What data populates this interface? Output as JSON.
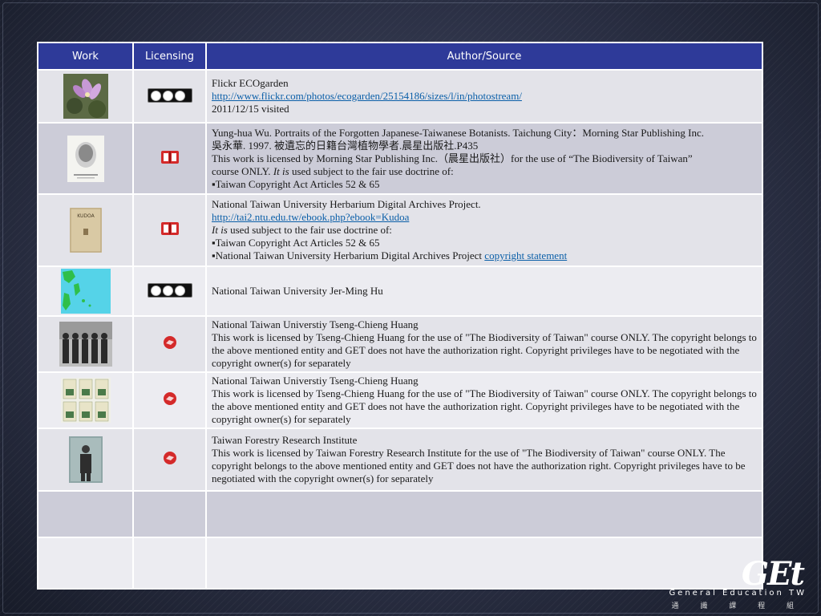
{
  "header": {
    "work": "Work",
    "licensing": "Licensing",
    "author": "Author/Source"
  },
  "rows": [
    {
      "lines": [
        "Flickr ECOgarden"
      ],
      "link": "http://www.flickr.com/photos/ecogarden/25154186/sizes/l/in/photostream/",
      "tail": [
        "2011/12/15 visited"
      ],
      "license": "cc-by-nc-nd",
      "thumb": "flower"
    },
    {
      "lines": [
        "Yung-hua Wu. Portraits of the Forgotten Japanese-Taiwanese Botanists. Taichung City：Morning Star Publishing Inc.",
        "吳永華. 1997. 被遺忘的日籍台灣植物學者.晨星出版社.P435",
        "This work is licensed by Morning Star Publishing Inc.（晨星出版社）for the use of “The Biodiversity of Taiwan”"
      ],
      "fair_prefix": "course ONLY.",
      "fair_italic": "It is",
      "fair_rest": "used subject to the fair use doctrine of:",
      "bullets": [
        "▪Taiwan Copyright Act Articles 52 & 65"
      ],
      "license": "fair-use",
      "thumb": "portrait"
    },
    {
      "lines": [
        "National Taiwan University Herbarium Digital Archives Project."
      ],
      "link": "http://tai2.ntu.edu.tw/ebook.php?ebook=Kudoa",
      "fair_italic": "It is",
      "fair_rest": "used subject to the fair use doctrine of:",
      "bullets": [
        "▪Taiwan Copyright Act Articles 52 & 65"
      ],
      "bullet_link_prefix": "▪National Taiwan University Herbarium Digital Archives Project",
      "bullet_link": "copyright statement",
      "license": "fair-use",
      "thumb": "book",
      "book_title": "KUDOA"
    },
    {
      "lines": [
        "National Taiwan University Jer-Ming Hu"
      ],
      "license": "cc-by-nc-sa",
      "thumb": "map"
    },
    {
      "lines": [
        "National Taiwan Universtiy Tseng-Chieng Huang"
      ],
      "body": "This work is licensed by Tseng-Chieng Huang for the use of \"The Biodiversity of Taiwan\" course ONLY.  The copyright belongs to the above mentioned entity and GET does not have the authorization right.  Copyright privileges have to be negotiated with the copyright owner(s) for separately",
      "license": "permission",
      "thumb": "group"
    },
    {
      "lines": [
        "National Taiwan Universtiy Tseng-Chieng Huang"
      ],
      "body": "This work is licensed by Tseng-Chieng Huang for the use of \"The Biodiversity of Taiwan\" course ONLY.  The copyright belongs to the above mentioned entity and GET does not have the authorization right.  Copyright privileges have to be negotiated with the copyright owner(s) for separately",
      "license": "permission",
      "thumb": "flora"
    },
    {
      "lines": [
        "Taiwan Forestry Research Institute"
      ],
      "body": "This work is licensed by Taiwan Forestry Research Institute for the use of \"The Biodiversity of Taiwan\" course ONLY.  The copyright belongs to the above mentioned entity and GET does not have the authorization right.  Copyright privileges have to be negotiated with the copyright owner(s) for separately",
      "license": "permission",
      "thumb": "photo"
    }
  ],
  "logo": {
    "brand": "GEt",
    "sub": "General Education TW",
    "sub_cjk": "通 識 課 程 組"
  },
  "colors": {
    "header": "#2e3a99",
    "link": "#0b5fa8",
    "red_icon": "#d42a2a"
  }
}
